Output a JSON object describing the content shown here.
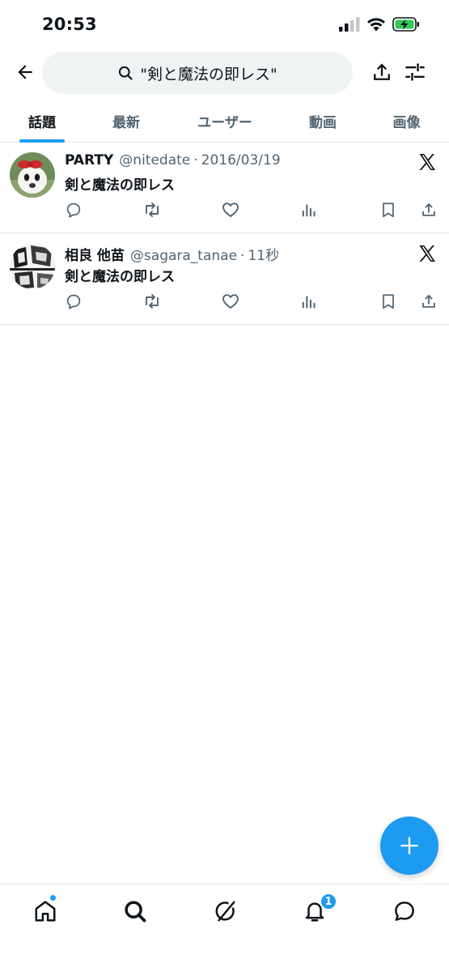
{
  "status_bar": {
    "time": "20:53",
    "icons": [
      "signal-icon",
      "wifi-icon",
      "battery-charging-icon"
    ],
    "battery_color": "#34c759"
  },
  "search": {
    "query": "\"剣と魔法の即レス\"",
    "icons": [
      "back-arrow-icon",
      "search-icon",
      "share-icon",
      "filter-icon"
    ]
  },
  "tabs": [
    {
      "label": "話題",
      "active": true
    },
    {
      "label": "最新",
      "active": false
    },
    {
      "label": "ユーザー",
      "active": false
    },
    {
      "label": "動画",
      "active": false
    },
    {
      "label": "画像",
      "active": false
    }
  ],
  "tweets": [
    {
      "name": "PARTY",
      "handle": "@nitedate",
      "separator": "·",
      "time": "2016/03/19",
      "text": "剣と魔法の即レス"
    },
    {
      "name": "相良 他苗",
      "handle": "@sagara_tanae",
      "separator": "·",
      "time": "11秒",
      "text": "剣と魔法の即レス"
    }
  ],
  "bottom_nav": {
    "items": [
      "home-icon",
      "search-icon",
      "grok-icon",
      "notifications-icon",
      "messages-icon"
    ],
    "notification_count": "1"
  },
  "colors": {
    "accent": "#1d9bf0",
    "text": "#0f1419",
    "secondary": "#536471"
  }
}
